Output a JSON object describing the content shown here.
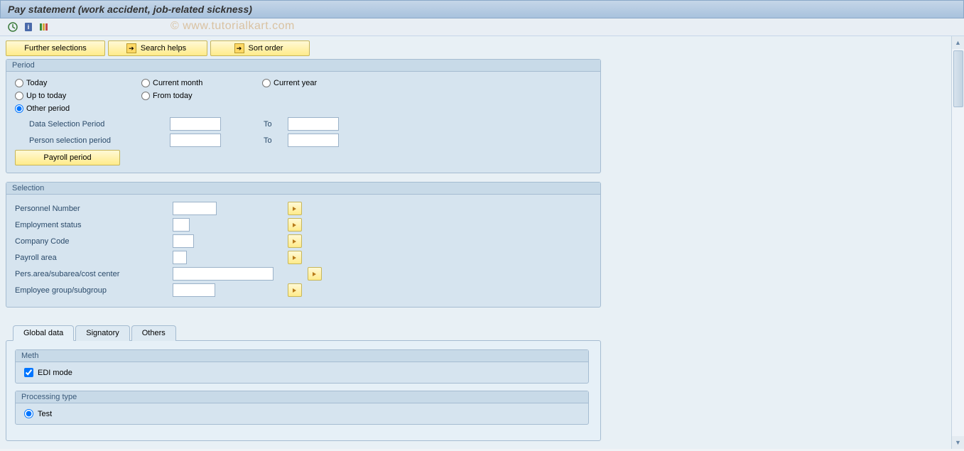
{
  "title": "Pay statement (work accident, job-related sickness)",
  "watermark": "© www.tutorialkart.com",
  "actionButtons": {
    "furtherSelections": "Further selections",
    "searchHelps": "Search helps",
    "sortOrder": "Sort order"
  },
  "periodGroup": {
    "title": "Period",
    "radios": {
      "today": "Today",
      "currentMonth": "Current month",
      "currentYear": "Current year",
      "upToToday": "Up to today",
      "fromToday": "From today",
      "otherPeriod": "Other period"
    },
    "dataSelectionPeriod": {
      "label": "Data Selection Period",
      "from": "",
      "toLabel": "To",
      "to": ""
    },
    "personSelectionPeriod": {
      "label": "Person selection period",
      "from": "",
      "toLabel": "To",
      "to": ""
    },
    "payrollPeriodBtn": "Payroll period"
  },
  "selectionGroup": {
    "title": "Selection",
    "fields": {
      "personnelNumber": {
        "label": "Personnel Number",
        "value": ""
      },
      "employmentStatus": {
        "label": "Employment status",
        "value": ""
      },
      "companyCode": {
        "label": "Company Code",
        "value": ""
      },
      "payrollArea": {
        "label": "Payroll area",
        "value": ""
      },
      "persArea": {
        "label": "Pers.area/subarea/cost center",
        "value": ""
      },
      "employeeGroup": {
        "label": "Employee group/subgroup",
        "value": ""
      }
    }
  },
  "tabs": {
    "globalData": "Global data",
    "signatory": "Signatory",
    "others": "Others"
  },
  "methGroup": {
    "title": "Meth",
    "ediMode": "EDI mode"
  },
  "processingTypeGroup": {
    "title": "Processing type",
    "test": "Test"
  }
}
